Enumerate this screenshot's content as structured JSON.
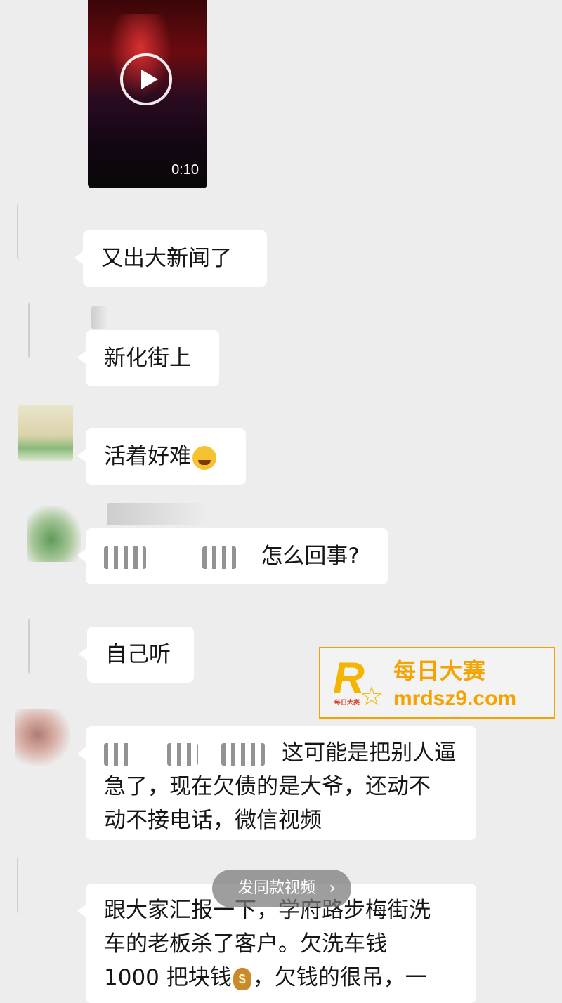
{
  "video": {
    "duration": "0:10"
  },
  "messages": [
    {
      "text": "又出大新闻了"
    },
    {
      "text": "新化街上"
    },
    {
      "text": "活着好难"
    },
    {
      "text": "怎么回事?"
    },
    {
      "text": "自己听"
    },
    {
      "text": "这可能是把别人逼",
      "line2": "急了，现在欠债的是大爷，还动不",
      "line3": "动不接电话，微信视频"
    },
    {
      "line1": "跟大家汇报一下，学府路步梅街洗",
      "line2": "车的老板杀了客户。欠洗车钱",
      "line3a": "1000 把块钱",
      "line3b": "，欠钱的很吊，一"
    }
  ],
  "watermark": {
    "brand": "每日大赛",
    "url": "mrdsz9.com",
    "logo_small": "每日大赛"
  },
  "float_button": {
    "label": "发同款视频",
    "icon": "chevron-right-icon"
  },
  "colors": {
    "background": "#ededed",
    "bubble": "#ffffff",
    "watermark": "#f5a300"
  }
}
